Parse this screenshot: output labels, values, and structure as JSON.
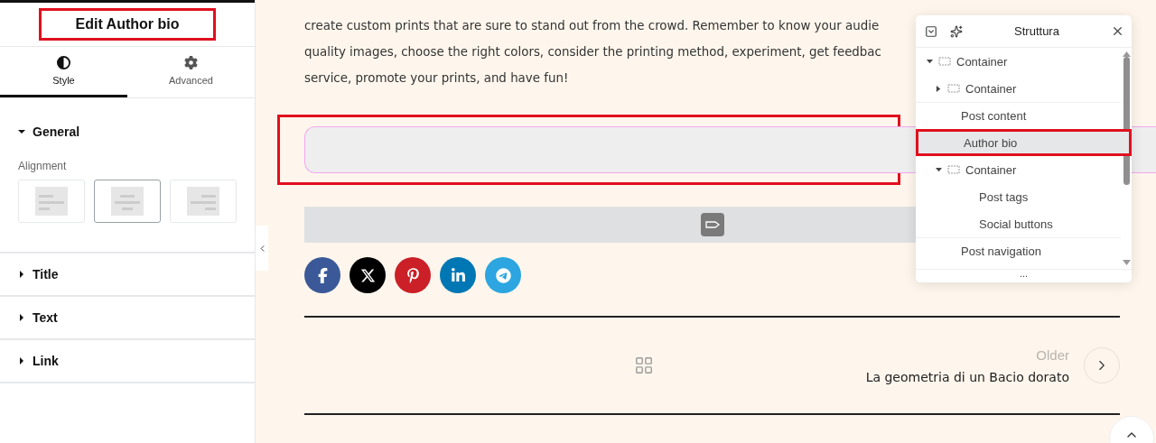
{
  "panel": {
    "title": "Edit Author bio",
    "tabs": [
      {
        "label": "Style",
        "selected": true
      },
      {
        "label": "Advanced",
        "selected": false
      }
    ],
    "sections": [
      {
        "label": "General",
        "expanded": true,
        "field": {
          "label": "Alignment",
          "options": [
            {
              "selected": false
            },
            {
              "selected": true
            },
            {
              "selected": false
            }
          ]
        }
      },
      {
        "label": "Title",
        "expanded": false
      },
      {
        "label": "Text",
        "expanded": false
      },
      {
        "label": "Link",
        "expanded": false
      }
    ]
  },
  "canvas": {
    "paragraph_lines": [
      "create custom prints that are sure to stand out from the crowd. Remember to know your audie",
      "quality images, choose the right colors, consider the printing method, experiment, get feedbac",
      "service, promote your prints, and have fun!"
    ],
    "social_buttons": [
      {
        "kind": "facebook",
        "color": "#3b5998"
      },
      {
        "kind": "x",
        "color": "#000000"
      },
      {
        "kind": "pinterest",
        "color": "#cb2027"
      },
      {
        "kind": "linkedin",
        "color": "#0077b5"
      },
      {
        "kind": "telegram",
        "color": "#2ca5e0"
      }
    ],
    "post_navigation": {
      "label": "Older",
      "title": "La geometria di un Bacio dorato"
    }
  },
  "structure": {
    "title": "Struttura",
    "tree": [
      {
        "label": "Container",
        "kind": "container",
        "expanded": true,
        "selected": false,
        "children": [
          {
            "label": "Container",
            "kind": "container",
            "expanded": false,
            "selected": false
          },
          {
            "label": "Post content",
            "kind": "widget",
            "selected": false
          },
          {
            "label": "Author bio",
            "kind": "widget",
            "selected": true
          },
          {
            "label": "Container",
            "kind": "container",
            "expanded": true,
            "selected": false,
            "children": [
              {
                "label": "Post tags",
                "kind": "widget",
                "selected": false
              },
              {
                "label": "Social buttons",
                "kind": "widget",
                "selected": false
              }
            ]
          },
          {
            "label": "Post navigation",
            "kind": "widget",
            "selected": false
          }
        ]
      }
    ],
    "more": "..."
  }
}
